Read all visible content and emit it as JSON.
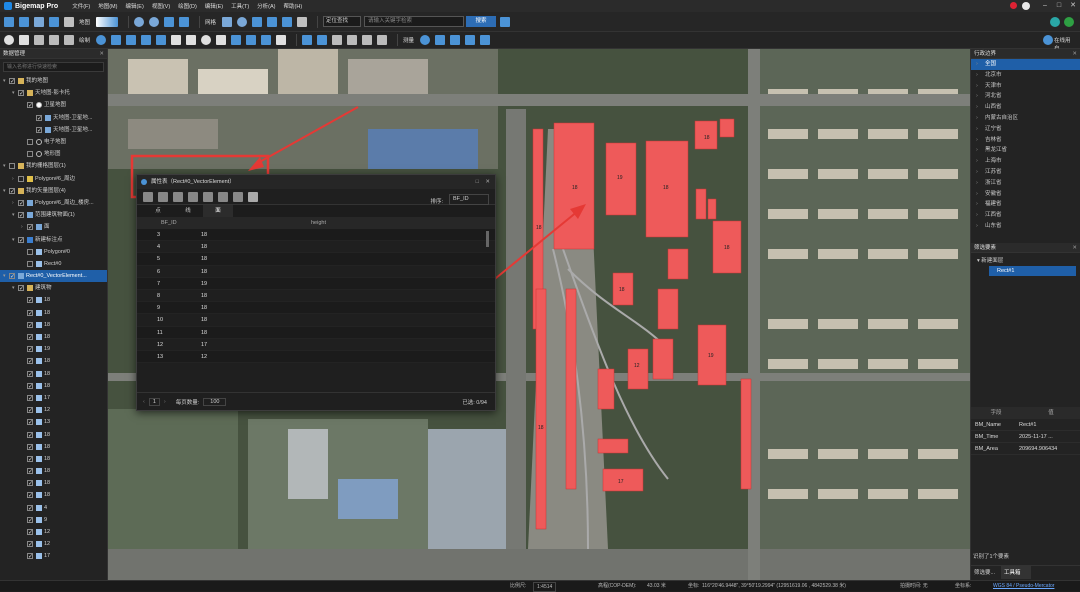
{
  "app": {
    "name": "Bigemap Pro",
    "menu": [
      "文件(F)",
      "地图(M)",
      "编辑(E)",
      "视图(V)",
      "绘图(D)",
      "编辑(E)",
      "工具(T)",
      "分析(A)",
      "帮助(H)"
    ]
  },
  "toolbar": {
    "map_label": "地图",
    "grid_label": "网格",
    "search_mode": "定位查找",
    "search_placeholder": "请输入关键字检索",
    "search_button": "搜索",
    "draw_label": "绘制",
    "measure_label": "测量",
    "online_label": "在线用户"
  },
  "left_panel": {
    "title": "数据管理",
    "search_placeholder": "输入名称进行快速检索",
    "items": [
      {
        "label": "我的地图",
        "level": 0,
        "checked": true,
        "arrow": "open",
        "icon": "folder"
      },
      {
        "label": "天地图-影卡托",
        "level": 1,
        "checked": true,
        "arrow": "open",
        "icon": "folder"
      },
      {
        "label": "卫星地图",
        "level": 2,
        "checked": true,
        "arrow": "none",
        "icon": "radio-on"
      },
      {
        "label": "天地图-卫星地...",
        "level": 3,
        "checked": true,
        "arrow": "none",
        "icon": "layer"
      },
      {
        "label": "天地图-卫星地...",
        "level": 3,
        "checked": true,
        "arrow": "none",
        "icon": "layer"
      },
      {
        "label": "电子地图",
        "level": 2,
        "checked": false,
        "arrow": "none",
        "icon": "radio"
      },
      {
        "label": "地形图",
        "level": 2,
        "checked": false,
        "arrow": "none",
        "icon": "radio"
      },
      {
        "label": "我的栅格图层(1)",
        "level": 0,
        "checked": false,
        "arrow": "open",
        "icon": "folder"
      },
      {
        "label": "Polygon#6_周边",
        "level": 1,
        "checked": false,
        "arrow": "closed",
        "icon": "folder-y"
      },
      {
        "label": "我的矢量图层(4)",
        "level": 0,
        "checked": true,
        "arrow": "open",
        "icon": "folder"
      },
      {
        "label": "Polygon#6_周边_楼房...",
        "level": 1,
        "checked": true,
        "arrow": "closed",
        "icon": "layer"
      },
      {
        "label": "范围建筑物面(1)",
        "level": 1,
        "checked": true,
        "arrow": "open",
        "icon": "layer"
      },
      {
        "label": "面",
        "level": 2,
        "checked": true,
        "arrow": "closed",
        "icon": "layer"
      },
      {
        "label": "新建标注点",
        "level": 1,
        "checked": true,
        "arrow": "open",
        "icon": "layer-b"
      },
      {
        "label": "Polygon#0",
        "level": 2,
        "checked": false,
        "arrow": "none",
        "icon": "poly"
      },
      {
        "label": "Rect#0",
        "level": 2,
        "checked": false,
        "arrow": "none",
        "icon": "poly"
      },
      {
        "label": "Rect#0_VectorElement...",
        "level": 0,
        "checked": true,
        "arrow": "open",
        "icon": "layer",
        "selected": true
      },
      {
        "label": "建筑物",
        "level": 1,
        "checked": true,
        "arrow": "open",
        "icon": "folder"
      },
      {
        "label": "18",
        "level": 2,
        "checked": true,
        "arrow": "none",
        "icon": "poly"
      },
      {
        "label": "18",
        "level": 2,
        "checked": true,
        "arrow": "none",
        "icon": "poly"
      },
      {
        "label": "18",
        "level": 2,
        "checked": true,
        "arrow": "none",
        "icon": "poly"
      },
      {
        "label": "18",
        "level": 2,
        "checked": true,
        "arrow": "none",
        "icon": "poly"
      },
      {
        "label": "19",
        "level": 2,
        "checked": true,
        "arrow": "none",
        "icon": "poly"
      },
      {
        "label": "18",
        "level": 2,
        "checked": true,
        "arrow": "none",
        "icon": "poly"
      },
      {
        "label": "18",
        "level": 2,
        "checked": true,
        "arrow": "none",
        "icon": "poly"
      },
      {
        "label": "18",
        "level": 2,
        "checked": true,
        "arrow": "none",
        "icon": "poly"
      },
      {
        "label": "17",
        "level": 2,
        "checked": true,
        "arrow": "none",
        "icon": "poly"
      },
      {
        "label": "12",
        "level": 2,
        "checked": true,
        "arrow": "none",
        "icon": "poly"
      },
      {
        "label": "13",
        "level": 2,
        "checked": true,
        "arrow": "none",
        "icon": "poly"
      },
      {
        "label": "18",
        "level": 2,
        "checked": true,
        "arrow": "none",
        "icon": "poly"
      },
      {
        "label": "18",
        "level": 2,
        "checked": true,
        "arrow": "none",
        "icon": "poly"
      },
      {
        "label": "18",
        "level": 2,
        "checked": true,
        "arrow": "none",
        "icon": "poly"
      },
      {
        "label": "18",
        "level": 2,
        "checked": true,
        "arrow": "none",
        "icon": "poly"
      },
      {
        "label": "18",
        "level": 2,
        "checked": true,
        "arrow": "none",
        "icon": "poly"
      },
      {
        "label": "18",
        "level": 2,
        "checked": true,
        "arrow": "none",
        "icon": "poly"
      },
      {
        "label": "4",
        "level": 2,
        "checked": true,
        "arrow": "none",
        "icon": "poly"
      },
      {
        "label": "9",
        "level": 2,
        "checked": true,
        "arrow": "none",
        "icon": "poly"
      },
      {
        "label": "12",
        "level": 2,
        "checked": true,
        "arrow": "none",
        "icon": "poly"
      },
      {
        "label": "12",
        "level": 2,
        "checked": true,
        "arrow": "none",
        "icon": "poly"
      },
      {
        "label": "17",
        "level": 2,
        "checked": true,
        "arrow": "none",
        "icon": "poly"
      }
    ]
  },
  "attribute_dialog": {
    "title": "属性表（Rect#0_VectorElement）",
    "field_label": "排序:",
    "field_value": "BF_ID",
    "tabs": [
      "点",
      "线",
      "面"
    ],
    "active_tab": 2,
    "columns": [
      "",
      "BF_ID",
      "height"
    ],
    "rows": [
      [
        "",
        "3",
        "18"
      ],
      [
        "",
        "4",
        "18"
      ],
      [
        "",
        "5",
        "18"
      ],
      [
        "",
        "6",
        "18"
      ],
      [
        "",
        "7",
        "19"
      ],
      [
        "",
        "8",
        "18"
      ],
      [
        "",
        "9",
        "18"
      ],
      [
        "",
        "10",
        "18"
      ],
      [
        "",
        "11",
        "18"
      ],
      [
        "",
        "12",
        "17"
      ],
      [
        "",
        "13",
        "12"
      ]
    ],
    "page": "1",
    "page_size_label": "每页数量:",
    "page_size": "100",
    "selected_label": "已选: 0/94"
  },
  "right_panel": {
    "admin_title": "行政边界",
    "regions": [
      "全国",
      "北京市",
      "天津市",
      "河北省",
      "山西省",
      "内蒙古自治区",
      "辽宁省",
      "吉林省",
      "黑龙江省",
      "上海市",
      "江苏省",
      "浙江省",
      "安徽省",
      "福建省",
      "江西省",
      "山东省"
    ],
    "selected_region": 0,
    "filter_title": "筛选要素",
    "filter_group": "新建面层",
    "filter_item": "Rect#1",
    "attr_header": [
      "字段",
      "值"
    ],
    "attrs": [
      {
        "k": "BM_Name",
        "v": "Rect#1"
      },
      {
        "k": "BM_Time",
        "v": "2025-11-17 ..."
      },
      {
        "k": "BM_Area",
        "v": "209694.906434"
      }
    ],
    "selected_count": "识别了1个要素",
    "bottom_tabs": [
      "筛选要...",
      "工具箱"
    ]
  },
  "status": {
    "scale_label": "比例尺:",
    "scale": "1:4514",
    "elevation_label": "高程(COP-DEM):",
    "elevation": "43.03 米",
    "coord_label": "坐标:",
    "coord": "116°20'46.9448\", 39°50'19.2994\"  (12951619.06 , 4842529.38 米)",
    "shot_label": "拍摄时间: 无",
    "crs_label": "坐标系:",
    "crs": "WGS 84 / Pseudo-Mercator"
  },
  "map_labels": [
    "18",
    "19",
    "18",
    "18",
    "18",
    "19",
    "18",
    "17",
    "12",
    "18",
    "18"
  ],
  "colors": {
    "accent": "#1f5fa8",
    "building": "#ee5a5a",
    "highlight": "#e53935"
  }
}
